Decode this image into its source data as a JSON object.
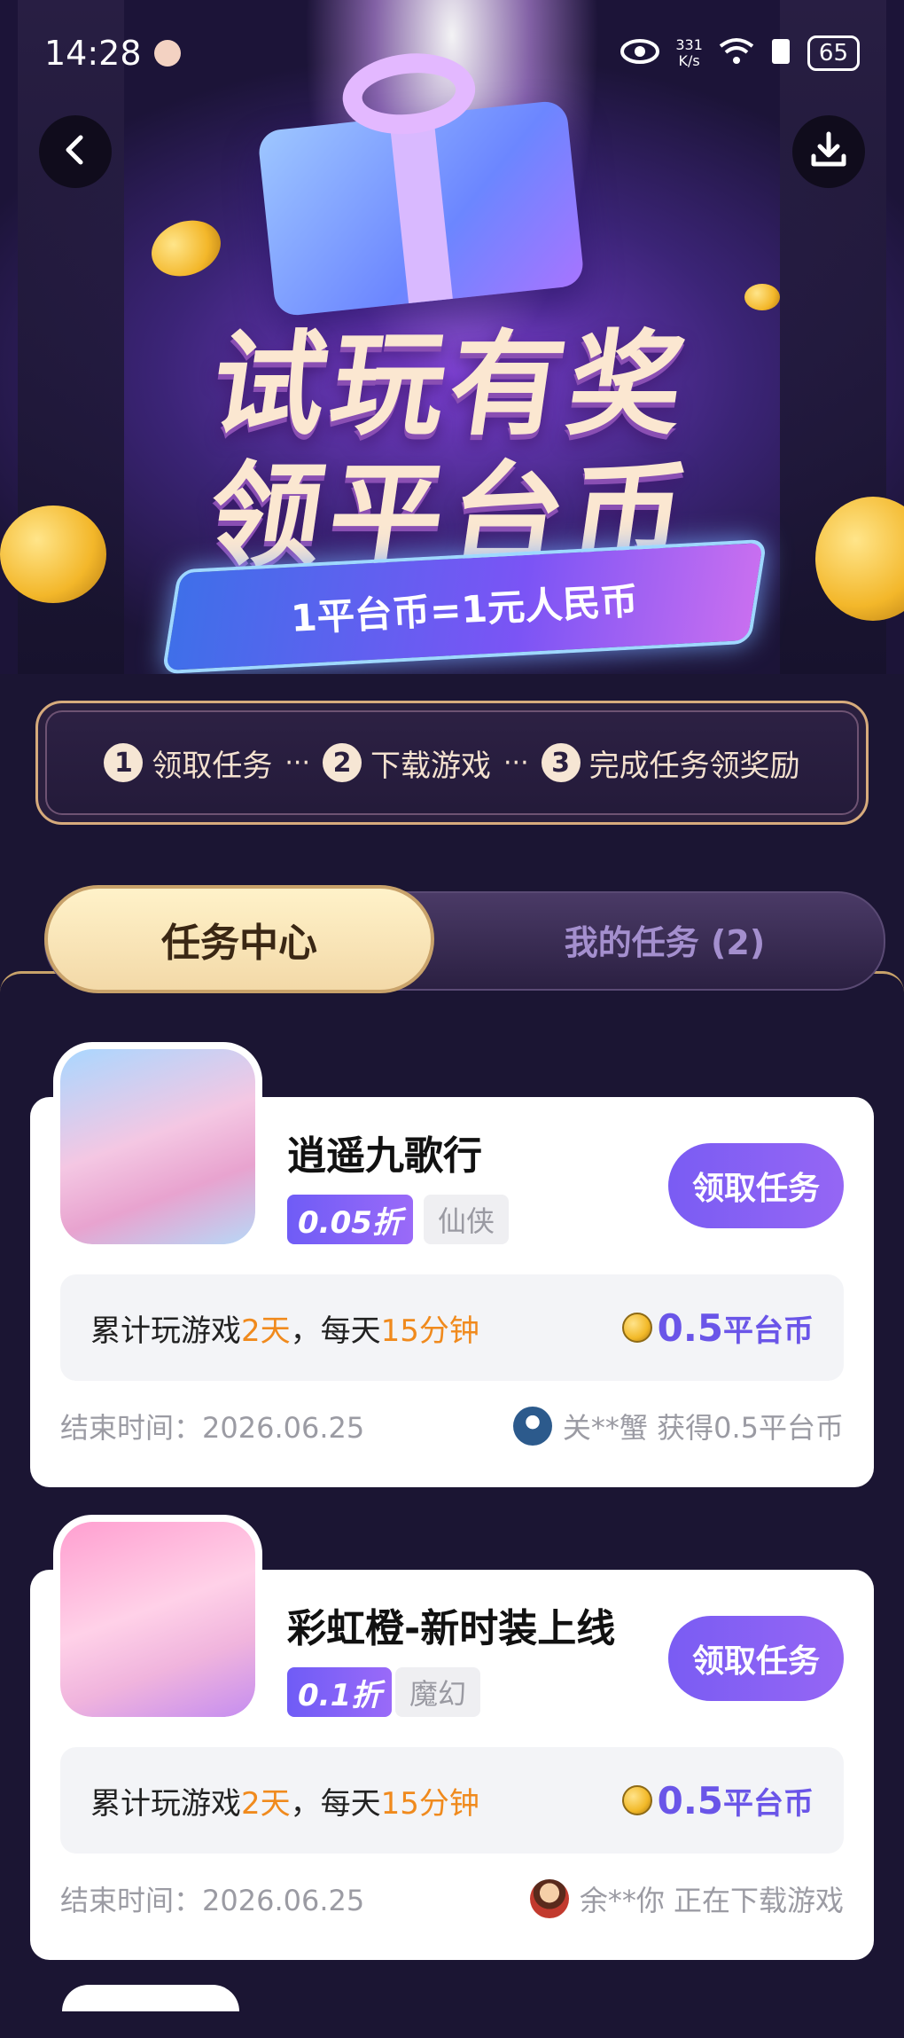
{
  "status_bar": {
    "time": "14:28",
    "net_speed_value": "331",
    "net_speed_unit": "K/s",
    "battery": "65"
  },
  "hero": {
    "title_line1": "试玩有奖",
    "title_line2": "领平台币",
    "rate": "1平台币=1元人民币"
  },
  "steps": [
    {
      "num": "1",
      "label": "领取任务"
    },
    {
      "num": "2",
      "label": "下载游戏"
    },
    {
      "num": "3",
      "label": "完成任务领奖励"
    }
  ],
  "step_separator": "···",
  "tabs": {
    "active": "任务中心",
    "inactive": "我的任务 (2)"
  },
  "cards": [
    {
      "name": "逍遥九歌行",
      "discount": "0.05折",
      "genre": "仙侠",
      "button": "领取任务",
      "task_prefix": "累计玩游戏",
      "task_days": "2天",
      "task_mid": "，每天",
      "task_minutes": "15分钟",
      "reward_amount": "0.5",
      "reward_unit": "平台币",
      "end_time": "结束时间：2026.06.25",
      "activity": "关**蟹  获得0.5平台币"
    },
    {
      "name": "彩虹橙-新时装上线",
      "discount": "0.1折",
      "genre": "魔幻",
      "button": "领取任务",
      "task_prefix": "累计玩游戏",
      "task_days": "2天",
      "task_mid": "，每天",
      "task_minutes": "15分钟",
      "reward_amount": "0.5",
      "reward_unit": "平台币",
      "end_time": "结束时间：2026.06.25",
      "activity": "余**你  正在下载游戏"
    }
  ],
  "colors": {
    "accent_purple": "#7a5cf3",
    "highlight_orange": "#f08a1d",
    "reward_purple": "#6a55e8",
    "gold": "#c8a26a"
  }
}
